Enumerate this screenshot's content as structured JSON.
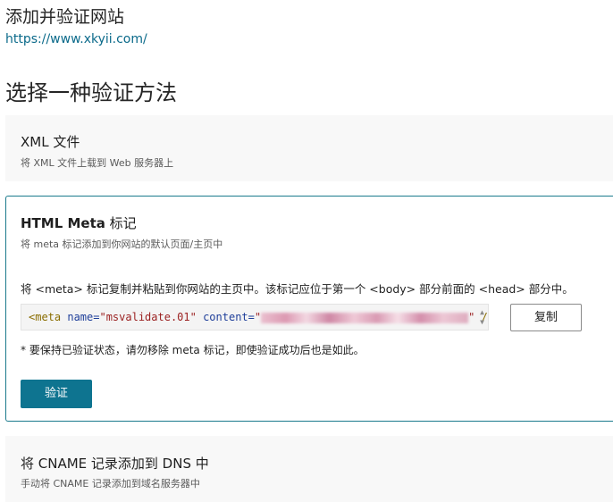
{
  "header": {
    "title": "添加并验证网站",
    "url": "https://www.xkyii.com/"
  },
  "section": {
    "title": "选择一种验证方法"
  },
  "methods": {
    "xml": {
      "title": "XML 文件",
      "desc": "将 XML 文件上载到 Web 服务器上"
    },
    "meta": {
      "title_bold": "HTML Meta",
      "title_light": " 标记",
      "desc": "将 meta 标记添加到你网站的默认页面/主页中",
      "instruction": "将 <meta> 标记复制并粘贴到你网站的主页中。该标记应位于第一个 <body> 部分前面的 <head> 部分中。",
      "code": {
        "open": "<meta",
        "attr_name": " name=",
        "name_value": "\"msvalidate.01\"",
        "attr_content": " content=",
        "content_quote_open": "\"",
        "content_quote_close": "\"",
        "close": " />"
      },
      "copy_label": "复制",
      "note": "* 要保持已验证状态，请勿移除 meta 标记，即使验证成功后也是如此。",
      "verify_label": "验证"
    },
    "cname": {
      "title": "将 CNAME 记录添加到 DNS 中",
      "desc": "手动将 CNAME 记录添加到域名服务器中"
    }
  },
  "icons": {
    "spinner_up": "▲",
    "spinner_down": "▼"
  },
  "colors": {
    "accent": "#0e7490",
    "link": "#0b6a8a",
    "selected_border": "#1a7a8c"
  }
}
